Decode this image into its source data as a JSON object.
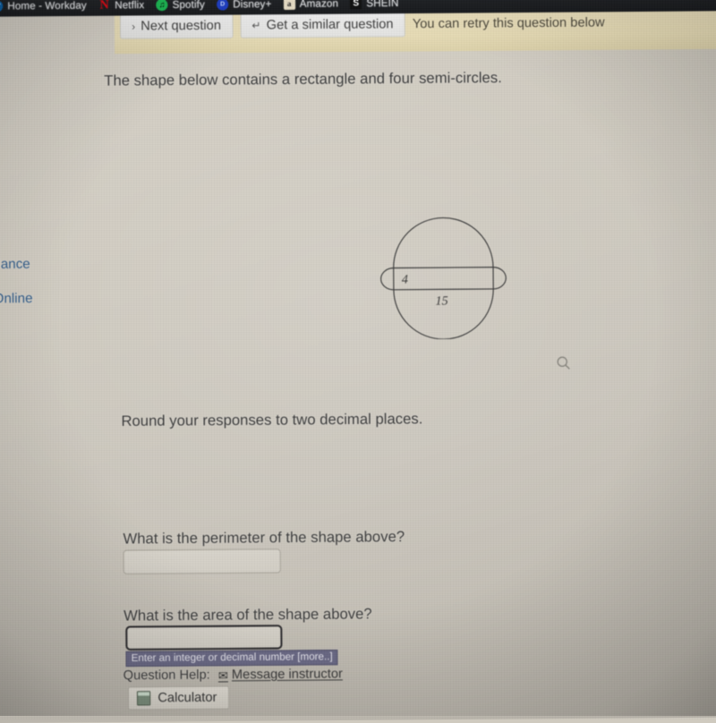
{
  "browser": {
    "bookmarks": [
      {
        "label": "Home - Workday",
        "icon": "workday-icon",
        "glyph": "W"
      },
      {
        "label": "Netflix",
        "icon": "netflix-icon",
        "glyph": "N"
      },
      {
        "label": "Spotify",
        "icon": "spotify-icon",
        "glyph": "♫"
      },
      {
        "label": "Disney+",
        "icon": "disney-icon",
        "glyph": "D"
      },
      {
        "label": "Amazon",
        "icon": "amazon-icon",
        "glyph": "a"
      },
      {
        "label": "SHEIN",
        "icon": "shein-icon",
        "glyph": "S"
      }
    ]
  },
  "question_bar": {
    "next_question_label": "Next question",
    "next_question_glyph": "›",
    "similar_question_label": "Get a similar question",
    "similar_question_glyph": "↵",
    "retry_note": "You can retry this question below"
  },
  "sidebar": {
    "items": [
      {
        "label": "dance"
      },
      {
        "label": "Online"
      }
    ]
  },
  "main": {
    "intro_text": "The shape below contains a rectangle and four semi-circles.",
    "rounding_text": "Round your responses to two decimal places.",
    "questions": [
      {
        "prompt": "What is the perimeter of the shape above?",
        "value": "",
        "tooltip": ""
      },
      {
        "prompt": "What is the area of the shape above?",
        "value": "",
        "tooltip": "Enter an integer or decimal number [more..]"
      }
    ],
    "zoom_icon": "magnifier-icon"
  },
  "figure": {
    "description": "Rectangle with a semi-circle on each of its four sides",
    "rect_height_label": "4",
    "rect_width_label": "15",
    "stroke_color": "#3b3b3b"
  },
  "help": {
    "label": "Question Help:",
    "message_instructor_label": "Message instructor",
    "envelope_glyph": "✉",
    "calculator_label": "Calculator"
  },
  "colors": {
    "page_background": "#cfcabf",
    "banner": "#e7dcb6",
    "bookmarks_bar": "#1e2023",
    "link_blue": "#2f5a87",
    "tooltip_background": "#6b6a86",
    "focus_border": "#2c2b2e"
  }
}
